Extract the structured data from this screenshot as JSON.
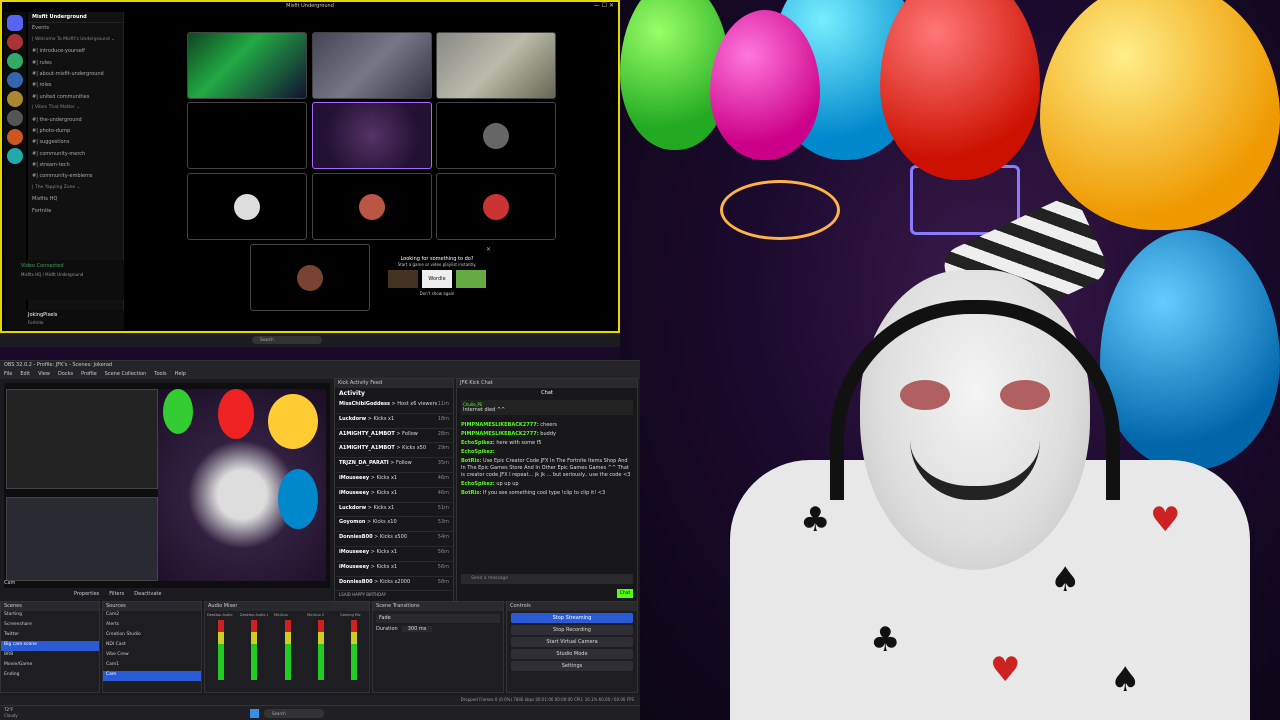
{
  "discord": {
    "window_title": "Misfit Underground",
    "server_name": "Misfit Underground",
    "channels": [
      {
        "label": "Events",
        "kind": "row"
      },
      {
        "label": "| Welcome To Misfit's Underground ⌄",
        "kind": "cat"
      },
      {
        "label": "#| introduce-yourself",
        "kind": "row"
      },
      {
        "label": "#| rules",
        "kind": "row"
      },
      {
        "label": "#| about-misfit-underground",
        "kind": "row"
      },
      {
        "label": "#| roles",
        "kind": "row"
      },
      {
        "label": "#| united communities",
        "kind": "row"
      },
      {
        "label": "| Vibes That Matter ⌄",
        "kind": "cat"
      },
      {
        "label": "#| the-underground",
        "kind": "row"
      },
      {
        "label": "#| photo-dump",
        "kind": "row"
      },
      {
        "label": "#| suggestions",
        "kind": "row"
      },
      {
        "label": "#| community-merch",
        "kind": "row"
      },
      {
        "label": "#| stream-tech",
        "kind": "row"
      },
      {
        "label": "#| community-emblems",
        "kind": "row"
      },
      {
        "label": "| The Yapping Zone ⌄",
        "kind": "cat"
      },
      {
        "label": "Misfits HQ",
        "kind": "row"
      },
      {
        "label": "Fortnite",
        "kind": "row"
      }
    ],
    "voice_status": "Video Connected",
    "voice_sub": "Misfits HQ / Misfit Underground",
    "user_name": "JokingPixels",
    "user_status": "Fortnite",
    "activity_prompt": "Looking for something to do?",
    "activity_sub": "Start a game or video playlist instantly.",
    "activity_games": [
      "",
      "Wordle",
      ""
    ],
    "dont_show": "Don't show again",
    "search_placeholder": "Search"
  },
  "obs": {
    "title": "OBS 32.0.2 - Profile: JFK's - Scenes: Jokerad",
    "menu": [
      "File",
      "Edit",
      "View",
      "Docks",
      "Profile",
      "Scene Collection",
      "Tools",
      "Help"
    ],
    "source_label": "Cam",
    "tabs": [
      "Properties",
      "Filters",
      "Deactivate"
    ],
    "docks": {
      "scenes": "Scenes",
      "sources": "Sources",
      "mixer": "Audio Mixer",
      "transitions": "Scene Transitions",
      "controls": "Controls"
    },
    "scenes": [
      "Starting",
      "Screenshare",
      "Twitter",
      "Big cam scene",
      "BRB",
      "Movie/Game",
      "Ending"
    ],
    "selected_scene_index": 3,
    "sources": [
      "Cam2",
      "Alerts",
      "Creation Studio",
      "NDI Cast",
      "Vibe Crew",
      "Cam1",
      "Cam"
    ],
    "transition": "Fade",
    "duration_label": "Duration",
    "duration": "300 ms",
    "controls": [
      "Stop Streaming",
      "Stop Recording",
      "Start Virtual Camera",
      "Studio Mode",
      "Settings"
    ],
    "mixer_channels": [
      "Desktop Audio",
      "Desktop Audio 2",
      "Mic/Aux",
      "Mic/Aux 2",
      "Gaming Mic"
    ],
    "status_bar": "Dropped Frames 0 (0.0%)   7846 kbps   00:01:06   00:00:00   CPU: 16.1%   60.00 / 60.00 FPS"
  },
  "kick_feed": {
    "title": "Kick Activity Feed",
    "header": "Activity",
    "items": [
      {
        "user": "MissChibiGoddess",
        "text": "> Host x6 viewers",
        "time": "11m"
      },
      {
        "user": "Luckdorw",
        "text": "> Kicks x1",
        "time": "18m"
      },
      {
        "user": "A1MIGHTY_A1MBOT",
        "text": "> Follow",
        "time": "28m"
      },
      {
        "user": "A1MIGHTY_A1MBOT",
        "text": "> Kicks x50",
        "time": "29m"
      },
      {
        "user": "TRJZN_DA_PARATI",
        "text": "> Follow",
        "time": "35m"
      },
      {
        "user": "iMouseeey",
        "text": "> Kicks x1",
        "time": "46m"
      },
      {
        "user": "iMouseeey",
        "text": "> Kicks x1",
        "time": "46m"
      },
      {
        "user": "Luckdorw",
        "text": "> Kicks x1",
        "time": "51m"
      },
      {
        "user": "Goyomon",
        "text": "> Kicks x10",
        "time": "53m"
      },
      {
        "user": "DonniesB00",
        "text": "> Kicks x500",
        "time": "54m"
      },
      {
        "user": "iMouseeey",
        "text": "> Kicks x1",
        "time": "56m"
      },
      {
        "user": "iMouseeey",
        "text": "> Kicks x1",
        "time": "56m"
      },
      {
        "user": "DonniesB00",
        "text": "> Kicks x2000",
        "time": "58m"
      }
    ],
    "footer": "LSAID HAPPY BIRTHDAY"
  },
  "kick_chat": {
    "title": "JFK Kick Chat",
    "header": "Chat",
    "pinned_user": "Chullo_PE",
    "pinned_text": "Internet died ^^",
    "messages": [
      {
        "user": "PIMPNAMESLIKEBACK2777:",
        "text": "cheers"
      },
      {
        "user": "PIMPNAMESLIKEBACK2777:",
        "text": "buddy"
      },
      {
        "user": "EchoSpikez:",
        "text": "here with some f5"
      },
      {
        "user": "EchoSpikez:",
        "text": ""
      },
      {
        "user": "BotRix:",
        "text": "Use Epic Creator Code JFX In The Fortnite Items Shop And In The Epic Games Store And In Other Epic Games Games ^^ That is creator code JFX I repeat... jk jk ... but seriously.. use the code <3"
      },
      {
        "user": "EchoSpikez:",
        "text": "up up up"
      },
      {
        "user": "BotRix:",
        "text": "If you see something cool type !clip to clip it! <3"
      }
    ],
    "input_placeholder": "Send a message",
    "send_label": "Chat"
  },
  "win_taskbar": {
    "search_placeholder": "Search",
    "weather_temp": "72°F",
    "weather_desc": "Cloudy"
  },
  "colors": {
    "kick_green": "#53fc18",
    "obs_blue": "#2a5bd7",
    "discord_border": "#e5d800"
  }
}
